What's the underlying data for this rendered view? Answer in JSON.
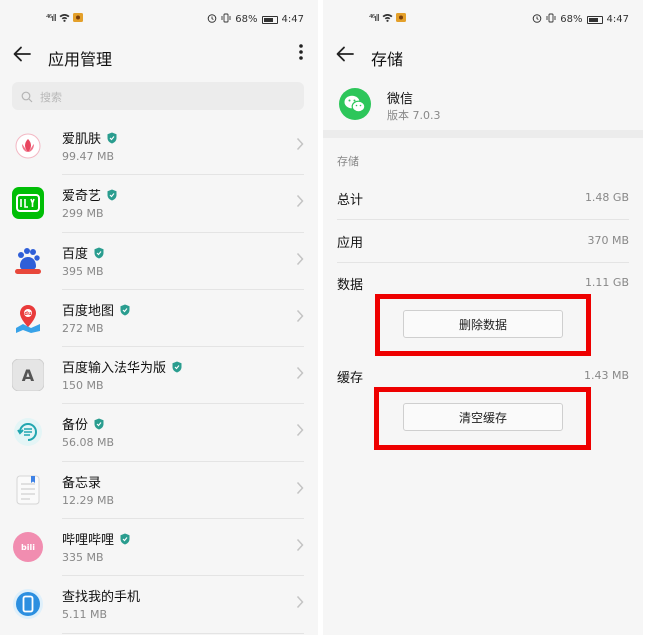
{
  "status_bar": {
    "signal": "⁴⁶ıll",
    "time": "4:47",
    "battery_pct": "68%"
  },
  "left": {
    "title": "应用管理",
    "search_placeholder": "搜索",
    "apps": [
      {
        "name": "爱肌肤",
        "size": "99.47 MB",
        "verified": true,
        "icon": "lotus-icon",
        "color": "#fdecef"
      },
      {
        "name": "爱奇艺",
        "size": "299 MB",
        "verified": true,
        "icon": "iqiyi-icon",
        "color": "#00be06"
      },
      {
        "name": "百度",
        "size": "395 MB",
        "verified": true,
        "icon": "baidu-paw-icon",
        "color": "#ffffff"
      },
      {
        "name": "百度地图",
        "size": "272 MB",
        "verified": true,
        "icon": "map-pin-icon",
        "color": "#ffffff"
      },
      {
        "name": "百度输入法华为版",
        "size": "150 MB",
        "verified": true,
        "icon": "keyboard-a-icon",
        "color": "#e6e6e6"
      },
      {
        "name": "备份",
        "size": "56.08 MB",
        "verified": true,
        "icon": "backup-icon",
        "color": "#e4f5f6"
      },
      {
        "name": "备忘录",
        "size": "12.29 MB",
        "verified": false,
        "icon": "notepad-icon",
        "color": "#f4f4f4"
      },
      {
        "name": "哔哩哔哩",
        "size": "335 MB",
        "verified": true,
        "icon": "bilibili-icon",
        "color": "#f18db0"
      },
      {
        "name": "查找我的手机",
        "size": "5.11 MB",
        "verified": false,
        "icon": "phone-finder-icon",
        "color": "#e3f1fb"
      }
    ]
  },
  "right": {
    "title": "存储",
    "app_name": "微信",
    "app_version": "版本 7.0.3",
    "storage_label": "存储",
    "total_label": "总计",
    "total_value": "1.48 GB",
    "app_label": "应用",
    "app_value": "370 MB",
    "data_label": "数据",
    "data_value": "1.11 GB",
    "delete_data_button": "删除数据",
    "cache_label": "缓存",
    "cache_value": "1.43 MB",
    "clear_cache_button": "清空缓存"
  }
}
